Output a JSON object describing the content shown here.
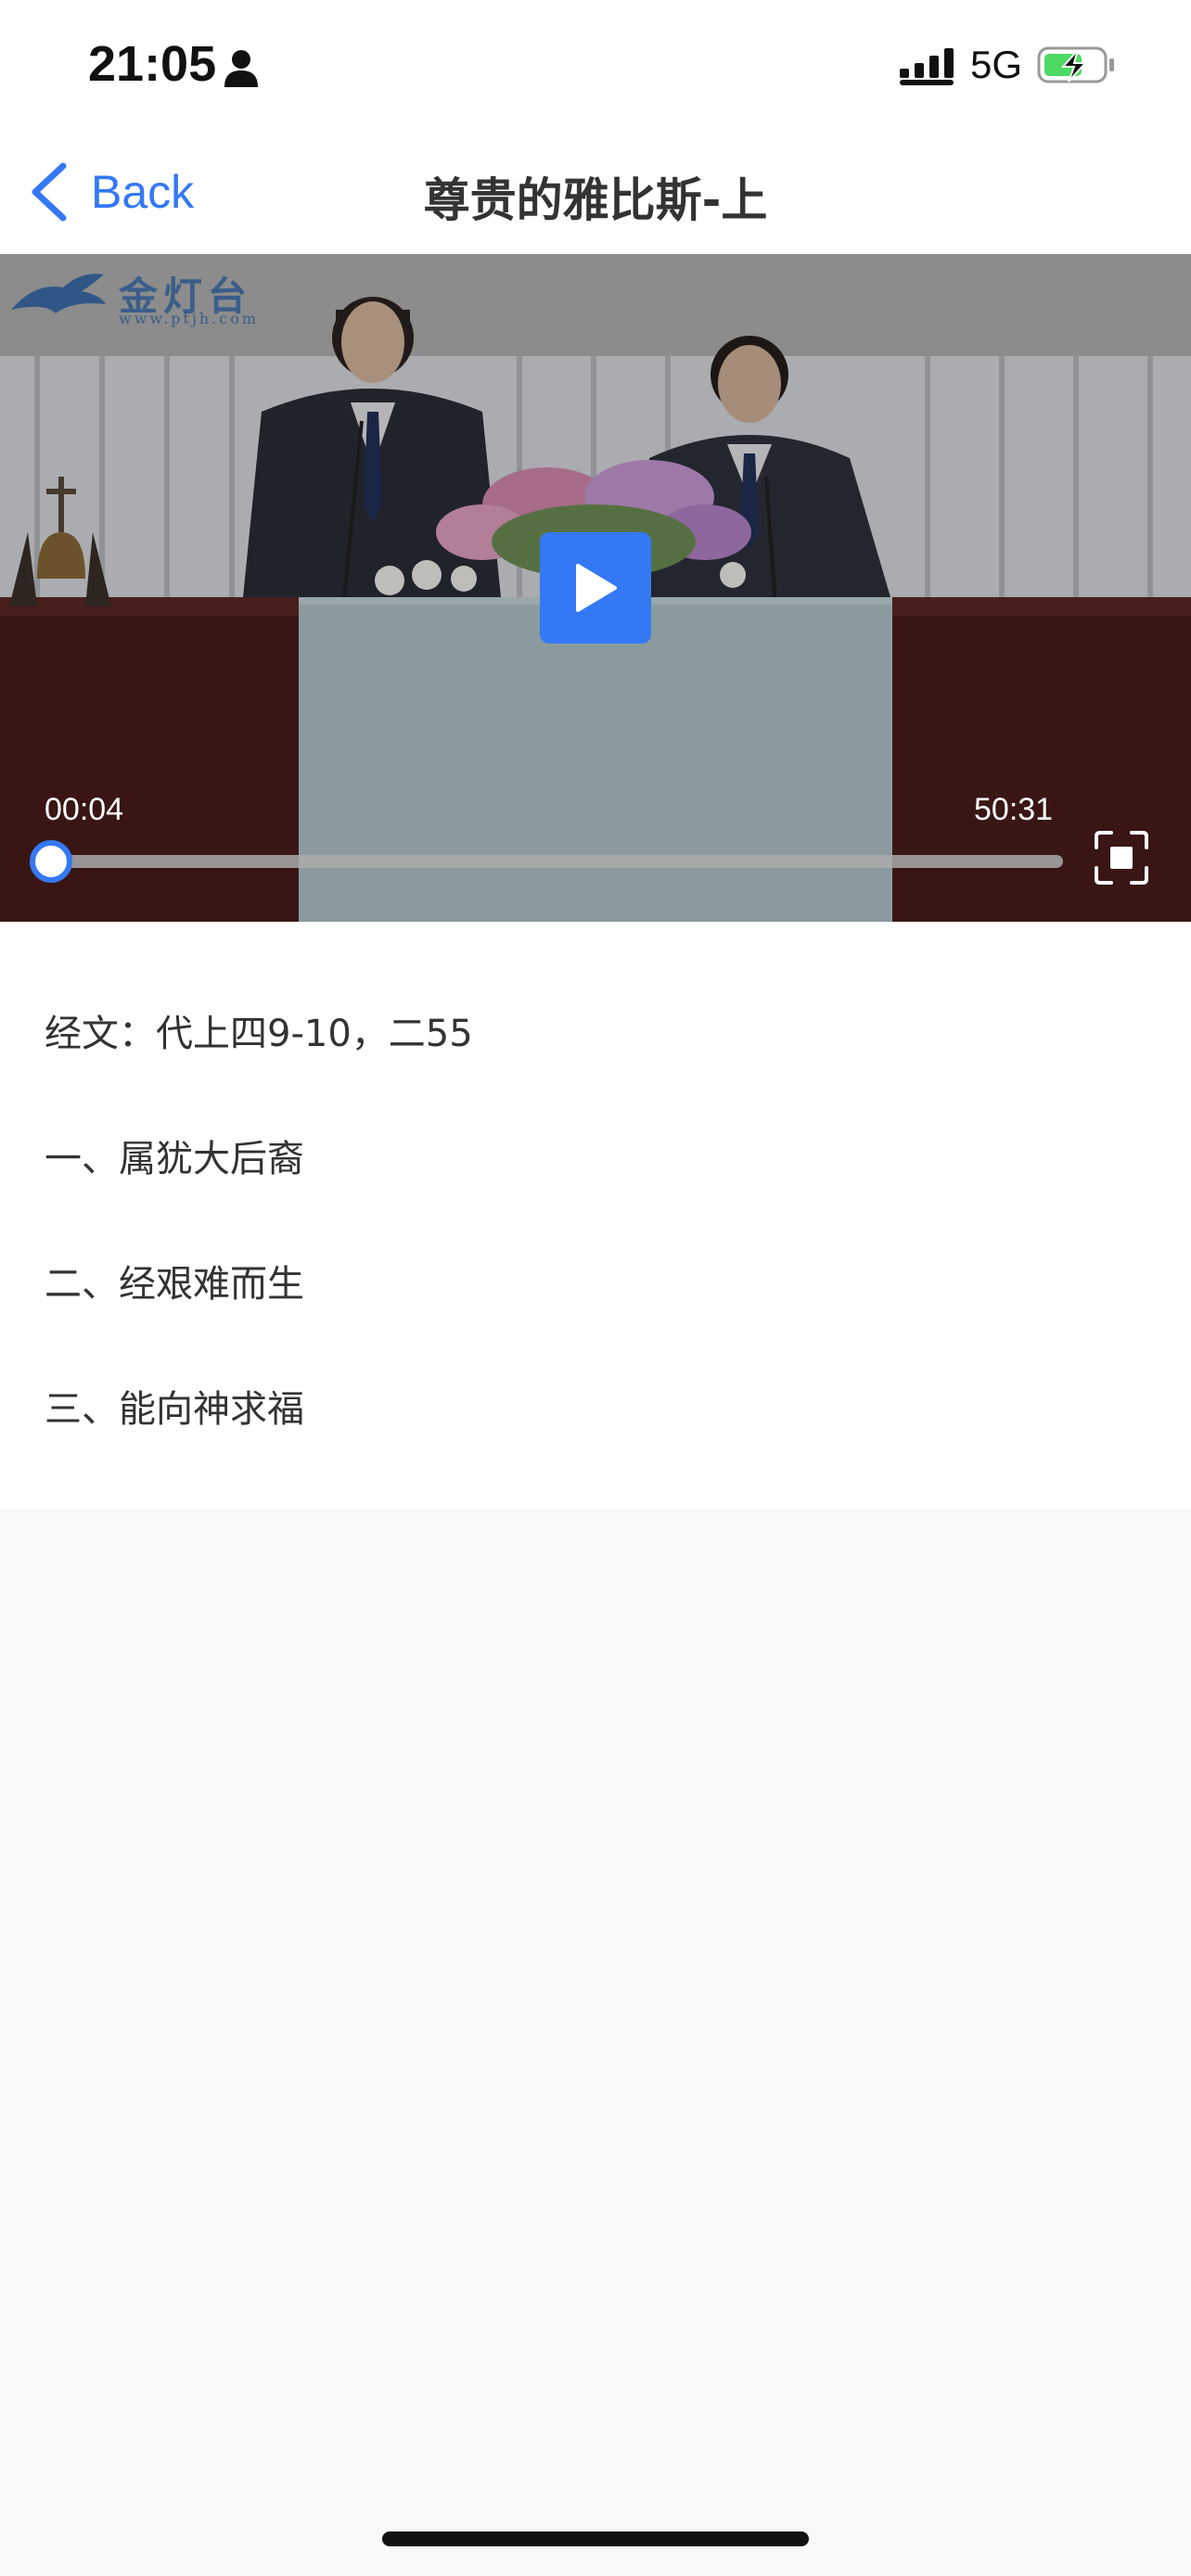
{
  "status_bar": {
    "time": "21:05",
    "network": "5G",
    "icons": [
      "person-icon",
      "signal-icon",
      "battery-charging-icon"
    ]
  },
  "nav": {
    "back_label": "Back",
    "title": "尊贵的雅比斯-上"
  },
  "video": {
    "watermark_text": "金灯台",
    "watermark_url": "www.ptjh.com",
    "elapsed": "00:04",
    "total": "50:31",
    "progress": 0.0013,
    "accent_color": "#3478f6",
    "icons": [
      "play-icon",
      "fullscreen-icon"
    ]
  },
  "content": {
    "lines": [
      "经文：代上四9-10，二55",
      "一、属犹大后裔",
      "二、经艰难而生",
      "三、能向神求福"
    ]
  }
}
